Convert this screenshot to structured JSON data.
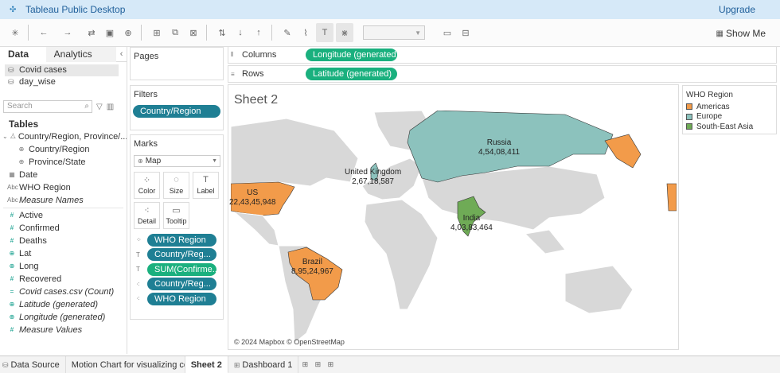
{
  "app": {
    "title": "Tableau Public Desktop",
    "upgrade": "Upgrade"
  },
  "toolbar": {
    "show_me": "Show Me"
  },
  "data_pane": {
    "tabs": [
      "Data",
      "Analytics"
    ],
    "collapse": "‹",
    "data_sources": [
      "Covid cases",
      "day_wise"
    ],
    "search_placeholder": "Search",
    "tables_heading": "Tables",
    "hierarchy": "Country/Region, Province/...",
    "hierarchy_children": [
      "Country/Region",
      "Province/State"
    ],
    "dimensions": [
      "Date",
      "WHO Region",
      "Measure Names"
    ],
    "measures": [
      "Active",
      "Confirmed",
      "Deaths",
      "Lat",
      "Long",
      "Recovered",
      "Covid cases.csv (Count)",
      "Latitude (generated)",
      "Longitude (generated)",
      "Measure Values"
    ]
  },
  "cards": {
    "pages": "Pages",
    "filters": "Filters",
    "filter_pill": "Country/Region",
    "marks": "Marks",
    "mark_type": "Map",
    "mark_buttons": [
      "Color",
      "Size",
      "Label",
      "Detail",
      "Tooltip"
    ],
    "mark_pills": [
      "WHO Region",
      "Country/Reg...",
      "SUM(Confirme...",
      "Country/Reg...",
      "WHO Region"
    ]
  },
  "shelves": {
    "columns_label": "Columns",
    "columns_pill": "Longitude (generated)",
    "rows_label": "Rows",
    "rows_pill": "Latitude (generated)"
  },
  "sheet": {
    "title": "Sheet 2",
    "attribution": "© 2024 Mapbox © OpenStreetMap",
    "labels": [
      {
        "country": "Russia",
        "value": "4,54,08,411"
      },
      {
        "country": "United Kingdom",
        "value": "2,67,18,587"
      },
      {
        "country": "US",
        "value": "22,43,45,948"
      },
      {
        "country": "India",
        "value": "4,03,83,464"
      },
      {
        "country": "Brazil",
        "value": "8,95,24,967"
      }
    ]
  },
  "legend": {
    "title": "WHO Region",
    "items": [
      {
        "name": "Americas",
        "color": "#f29b4a"
      },
      {
        "name": "Europe",
        "color": "#8cc2bd"
      },
      {
        "name": "South-East Asia",
        "color": "#6fab56"
      }
    ]
  },
  "tabs": {
    "data_source": "Data Source",
    "sheets": [
      "Motion Chart for visualizing con...",
      "Sheet 2",
      "Dashboard 1"
    ]
  },
  "colors": {
    "americas": "#f29b4a",
    "europe": "#8cc2bd",
    "sea": "#6fab56",
    "land": "#d8d8d8",
    "dim_pill": "#1f7f94",
    "meas_pill": "#1ab07e"
  }
}
